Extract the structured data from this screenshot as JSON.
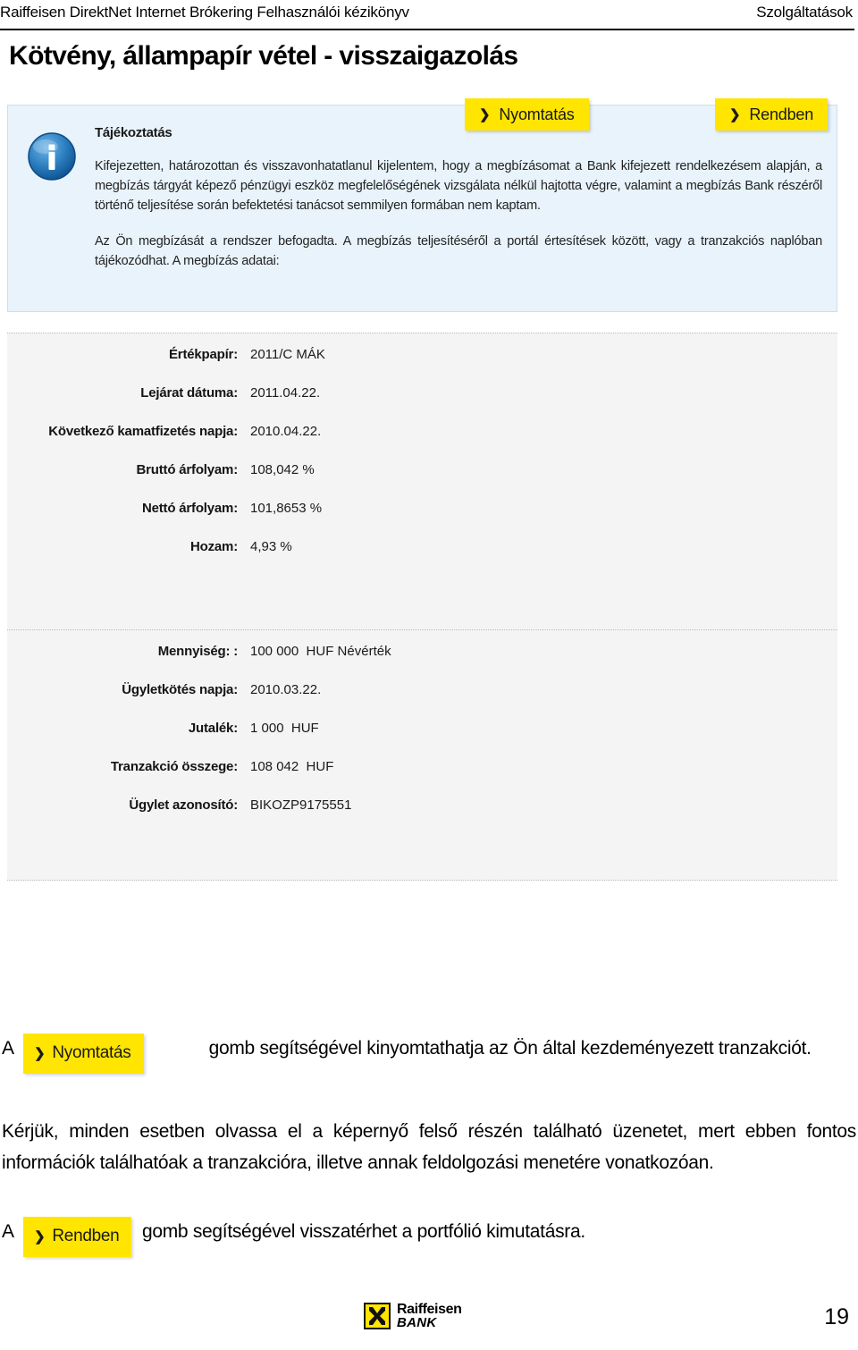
{
  "header": {
    "left": "Raiffeisen DirektNet Internet Brókering Felhasználói kézikönyv",
    "right": "Szolgáltatások"
  },
  "page_title": "Kötvény, állampapír vétel - visszaigazolás",
  "notice": {
    "icon": "info-icon",
    "title": "Tájékoztatás",
    "paragraph_1": "Kifejezetten, határozottan és visszavonhatatlanul kijelentem, hogy a megbízásomat a Bank kifejezett rendelkezésem alapján, a megbízás tárgyát képező pénzügyi eszköz megfelelőségének vizsgálata nélkül hajtotta végre, valamint a megbízás Bank részéről történő teljesítése során befektetési tanácsot semmilyen formában nem kaptam.",
    "paragraph_2": "Az Ön megbízását a rendszer befogadta. A megbízás teljesítéséről a portál értesítések között, vagy a tranzakciós naplóban tájékozódhat. A megbízás adatai:"
  },
  "details": {
    "group_a": [
      {
        "label": "Értékpapír:",
        "value": "2011/C MÁK"
      },
      {
        "label": "Lejárat dátuma:",
        "value": "2011.04.22."
      },
      {
        "label": "Következő kamatfizetés napja:",
        "value": "2010.04.22."
      },
      {
        "label": "Bruttó árfolyam:",
        "value": "108,042 %"
      },
      {
        "label": "Nettó árfolyam:",
        "value": "101,8653 %"
      },
      {
        "label": "Hozam:",
        "value": "4,93 %"
      }
    ],
    "group_b": [
      {
        "label": "Mennyiség: :",
        "value": "100 000  HUF Névérték"
      },
      {
        "label": "Ügyletkötés napja:",
        "value": "2010.03.22."
      },
      {
        "label": "Jutalék:",
        "value": "1 000  HUF"
      },
      {
        "label": "Tranzakció összege:",
        "value": "108 042  HUF"
      },
      {
        "label": "Ügylet azonosító:",
        "value": "BIKOZP9175551"
      }
    ]
  },
  "buttons": {
    "chevron": "❯",
    "print": "Nyomtatás",
    "ok": "Rendben"
  },
  "explanation": {
    "para1_prefix": "A",
    "para1_suffix": "gomb segítségével kinyomtathatja az Ön által kezdeményezett tranzakciót.",
    "para2": "Kérjük, minden esetben olvassa el a képernyő felső részén található üzenetet, mert ebben fontos információk találhatóak a tranzakcióra, illetve annak feldolgozási menetére vonatkozóan.",
    "para3_prefix": "A",
    "para3_suffix": "gomb segítségével visszatérhet a portfólió kimutatásra."
  },
  "footer": {
    "logo_line1": "Raiffeisen",
    "logo_line2": "BANK",
    "page_number": "19"
  },
  "colors": {
    "accent_yellow": "#ffe500",
    "info_bg": "#e8f3fb",
    "panel_bg": "#f4f4f4",
    "info_icon_blue": "#1f6fb5"
  }
}
